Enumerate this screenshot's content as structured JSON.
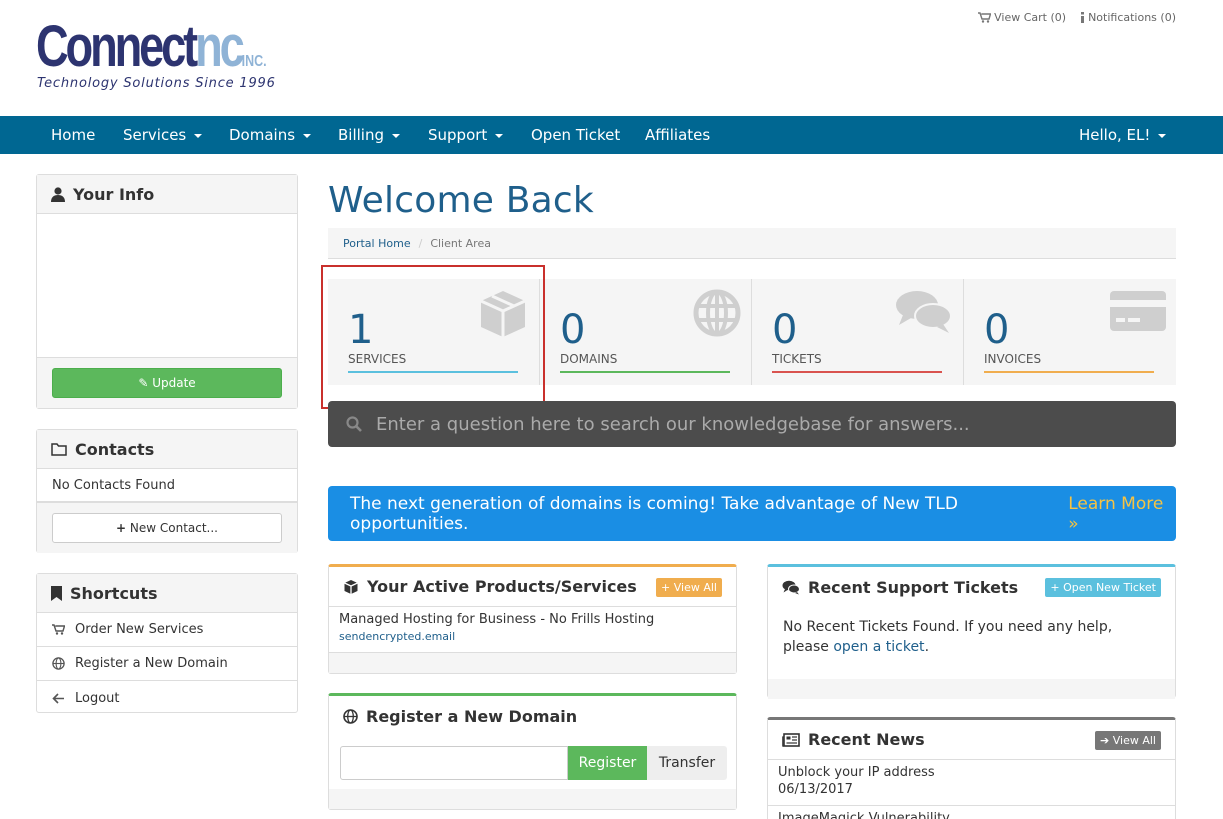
{
  "brand": {
    "name": "Connect",
    "name_suffix": "nc",
    "inc": "INC.",
    "tagline": "Technology Solutions Since 1996"
  },
  "toplinks": {
    "cart": "View Cart (0)",
    "notifications": "Notifications (0)"
  },
  "nav": {
    "items": [
      "Home",
      "Services",
      "Domains",
      "Billing",
      "Support",
      "Open Ticket",
      "Affiliates"
    ],
    "user": "Hello, EL!"
  },
  "sidebar": {
    "your_info": {
      "title": "Your Info",
      "update": "Update"
    },
    "contacts": {
      "title": "Contacts",
      "empty": "No Contacts Found",
      "new": "New Contact..."
    },
    "shortcuts": {
      "title": "Shortcuts",
      "items": [
        "Order New Services",
        "Register a New Domain",
        "Logout"
      ]
    }
  },
  "main": {
    "title": "Welcome Back",
    "breadcrumb": {
      "home": "Portal Home",
      "current": "Client Area"
    },
    "stats": [
      {
        "value": "1",
        "label": "SERVICES",
        "color": "#5bc0de"
      },
      {
        "value": "0",
        "label": "DOMAINS",
        "color": "#5cb85c"
      },
      {
        "value": "0",
        "label": "TICKETS",
        "color": "#d9534f"
      },
      {
        "value": "0",
        "label": "INVOICES",
        "color": "#f0ad4e"
      }
    ],
    "search_placeholder": "Enter a question here to search our knowledgebase for answers...",
    "promo": {
      "text": "The next generation of domains is coming! Take advantage of New TLD opportunities.",
      "link": "Learn More »"
    },
    "products": {
      "title": "Your Active Products/Services",
      "view_all": "View All",
      "item_name": "Managed Hosting for Business - No Frills Hosting",
      "item_domain": "sendencrypted.email"
    },
    "register_domain": {
      "title": "Register a New Domain",
      "register": "Register",
      "transfer": "Transfer"
    },
    "tickets": {
      "title": "Recent Support Tickets",
      "button": "Open New Ticket",
      "text": "No Recent Tickets Found. If you need any help, please",
      "link": "open a ticket",
      "end": "."
    },
    "news": {
      "title": "Recent News",
      "view_all": "View All",
      "items": [
        {
          "title": "Unblock your IP address",
          "date": "06/13/2017"
        },
        {
          "title": "ImageMagick Vulnerability"
        }
      ]
    }
  },
  "colors": {
    "navbar": "#006792",
    "accent": "#1f5f8b",
    "green": "#5cb85c",
    "orange": "#f0ad4e",
    "info": "#5bc0de"
  }
}
